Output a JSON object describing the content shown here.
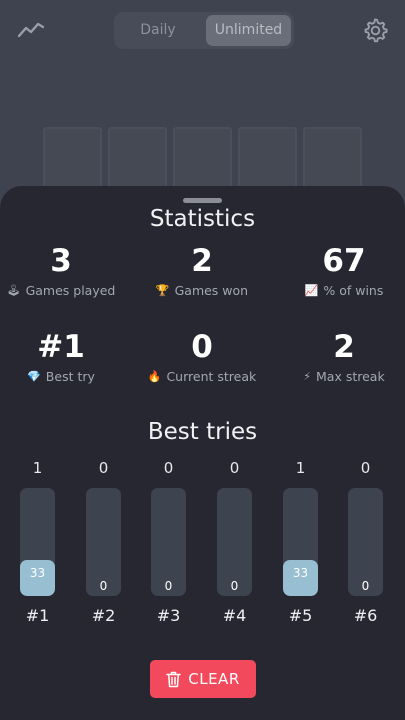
{
  "header": {
    "tabs": [
      "Daily",
      "Unlimited"
    ],
    "active_tab": "Unlimited"
  },
  "board_preview": {
    "tile_count": 5
  },
  "statistics": {
    "title": "Statistics",
    "items": [
      {
        "value": "3",
        "label": "Games played",
        "icon": "joystick-icon",
        "glyph": "🕹"
      },
      {
        "value": "2",
        "label": "Games won",
        "icon": "trophy-icon",
        "glyph": "🏆"
      },
      {
        "value": "67",
        "label": "% of wins",
        "icon": "chart-icon",
        "glyph": "📈"
      },
      {
        "value": "#1",
        "label": "Best try",
        "icon": "gem-icon",
        "glyph": "💎"
      },
      {
        "value": "0",
        "label": "Current streak",
        "icon": "fire-icon",
        "glyph": "🔥"
      },
      {
        "value": "2",
        "label": "Max streak",
        "icon": "lightning-icon",
        "glyph": "⚡"
      }
    ]
  },
  "best_tries": {
    "title": "Best tries",
    "bars": [
      {
        "label": "#1",
        "count": "1",
        "percent": "33",
        "fill": 0.33
      },
      {
        "label": "#2",
        "count": "0",
        "percent": "0",
        "fill": 0
      },
      {
        "label": "#3",
        "count": "0",
        "percent": "0",
        "fill": 0
      },
      {
        "label": "#4",
        "count": "0",
        "percent": "0",
        "fill": 0
      },
      {
        "label": "#5",
        "count": "1",
        "percent": "33",
        "fill": 0.33
      },
      {
        "label": "#6",
        "count": "0",
        "percent": "0",
        "fill": 0
      }
    ]
  },
  "clear_button": {
    "label": "CLEAR"
  },
  "colors": {
    "sheet_background": "#262731",
    "bar_fill": "#97bfd1",
    "bar_track": "#3d4450",
    "clear_button": "#f24a5c"
  }
}
